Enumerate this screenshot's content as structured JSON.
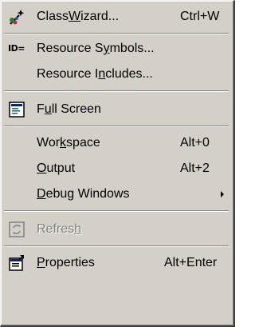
{
  "menu": {
    "items": [
      {
        "label": "ClassWizard...",
        "shortcut": "Ctrl+W",
        "icon": "classwizard-icon"
      },
      {
        "label": "Resource Symbols...",
        "icon": "id-equals-icon"
      },
      {
        "label": "Resource Includes..."
      },
      {
        "label": "Full Screen",
        "icon": "full-screen-icon"
      },
      {
        "label": "Workspace",
        "shortcut": "Alt+0"
      },
      {
        "label": "Output",
        "shortcut": "Alt+2"
      },
      {
        "label": "Debug Windows",
        "submenu": true
      },
      {
        "label": "Refresh",
        "icon": "refresh-icon",
        "disabled": true
      },
      {
        "label": "Properties",
        "shortcut": "Alt+Enter",
        "icon": "properties-icon"
      }
    ],
    "id_glyph_text": "ID="
  }
}
